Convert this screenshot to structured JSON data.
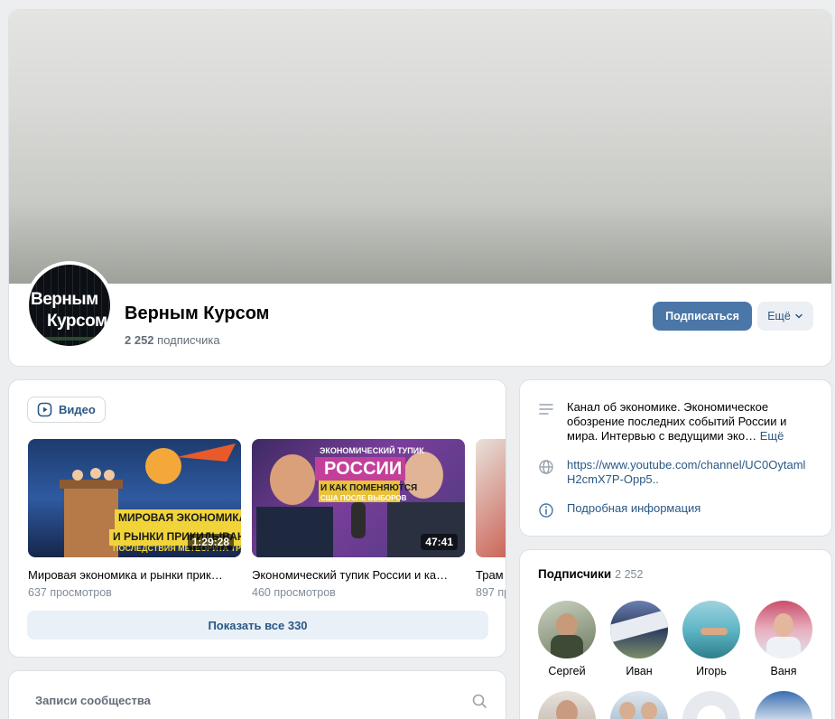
{
  "header": {
    "group_name": "Верным Курсом",
    "subscribers_count": "2 252",
    "subscribers_label": "подписчика",
    "subscribe_label": "Подписаться",
    "more_label": "Ещё",
    "avatar_text_1": "Верным",
    "avatar_text_2": "Курсом"
  },
  "videos": {
    "tab_label": "Видео",
    "items": [
      {
        "title": "Мировая экономика и рынки прик…",
        "views": "637 просмотров",
        "duration": "1:29:28",
        "caption_1": "МИРОВАЯ ЭКОНОМИКА",
        "caption_2": "И РЫНКИ ПРИКИДЫВАЮТ",
        "caption_3": "ПОСЛЕДСТВИЯ МЕТЕОРИТА ТРАМП"
      },
      {
        "title": "Экономический тупик России и ка…",
        "views": "460 просмотров",
        "duration": "47:41",
        "caption_1": "ЭКОНОМИЧЕСКИЙ ТУПИК",
        "caption_2": "РОССИИ",
        "caption_3": "И КАК ПОМЕНЯЮТСЯ",
        "caption_4": "США ПОСЛЕ ВЫБОРОВ"
      },
      {
        "title": "Трам",
        "views": "897 пр",
        "duration": ""
      }
    ],
    "show_all_label": "Показать все 330"
  },
  "posts": {
    "title": "Записи сообщества"
  },
  "info": {
    "description": "Канал об экономике. Экономическое обозрение последних событий России и мира. Интервью с ведущими эко…",
    "description_more": "Ещё",
    "link_line_1": "https://www.youtube.com/channel/UC0Oytaml",
    "link_line_2": "H2cmX7P-Opp5..",
    "details_label": "Подробная информация"
  },
  "followers": {
    "title": "Подписчики",
    "count": "2 252",
    "people": [
      {
        "name": "Сергей"
      },
      {
        "name": "Иван"
      },
      {
        "name": "Игорь"
      },
      {
        "name": "Ваня"
      }
    ]
  },
  "colors": {
    "accent": "#4a76a8",
    "link": "#2a5885",
    "background": "#edeef0"
  }
}
